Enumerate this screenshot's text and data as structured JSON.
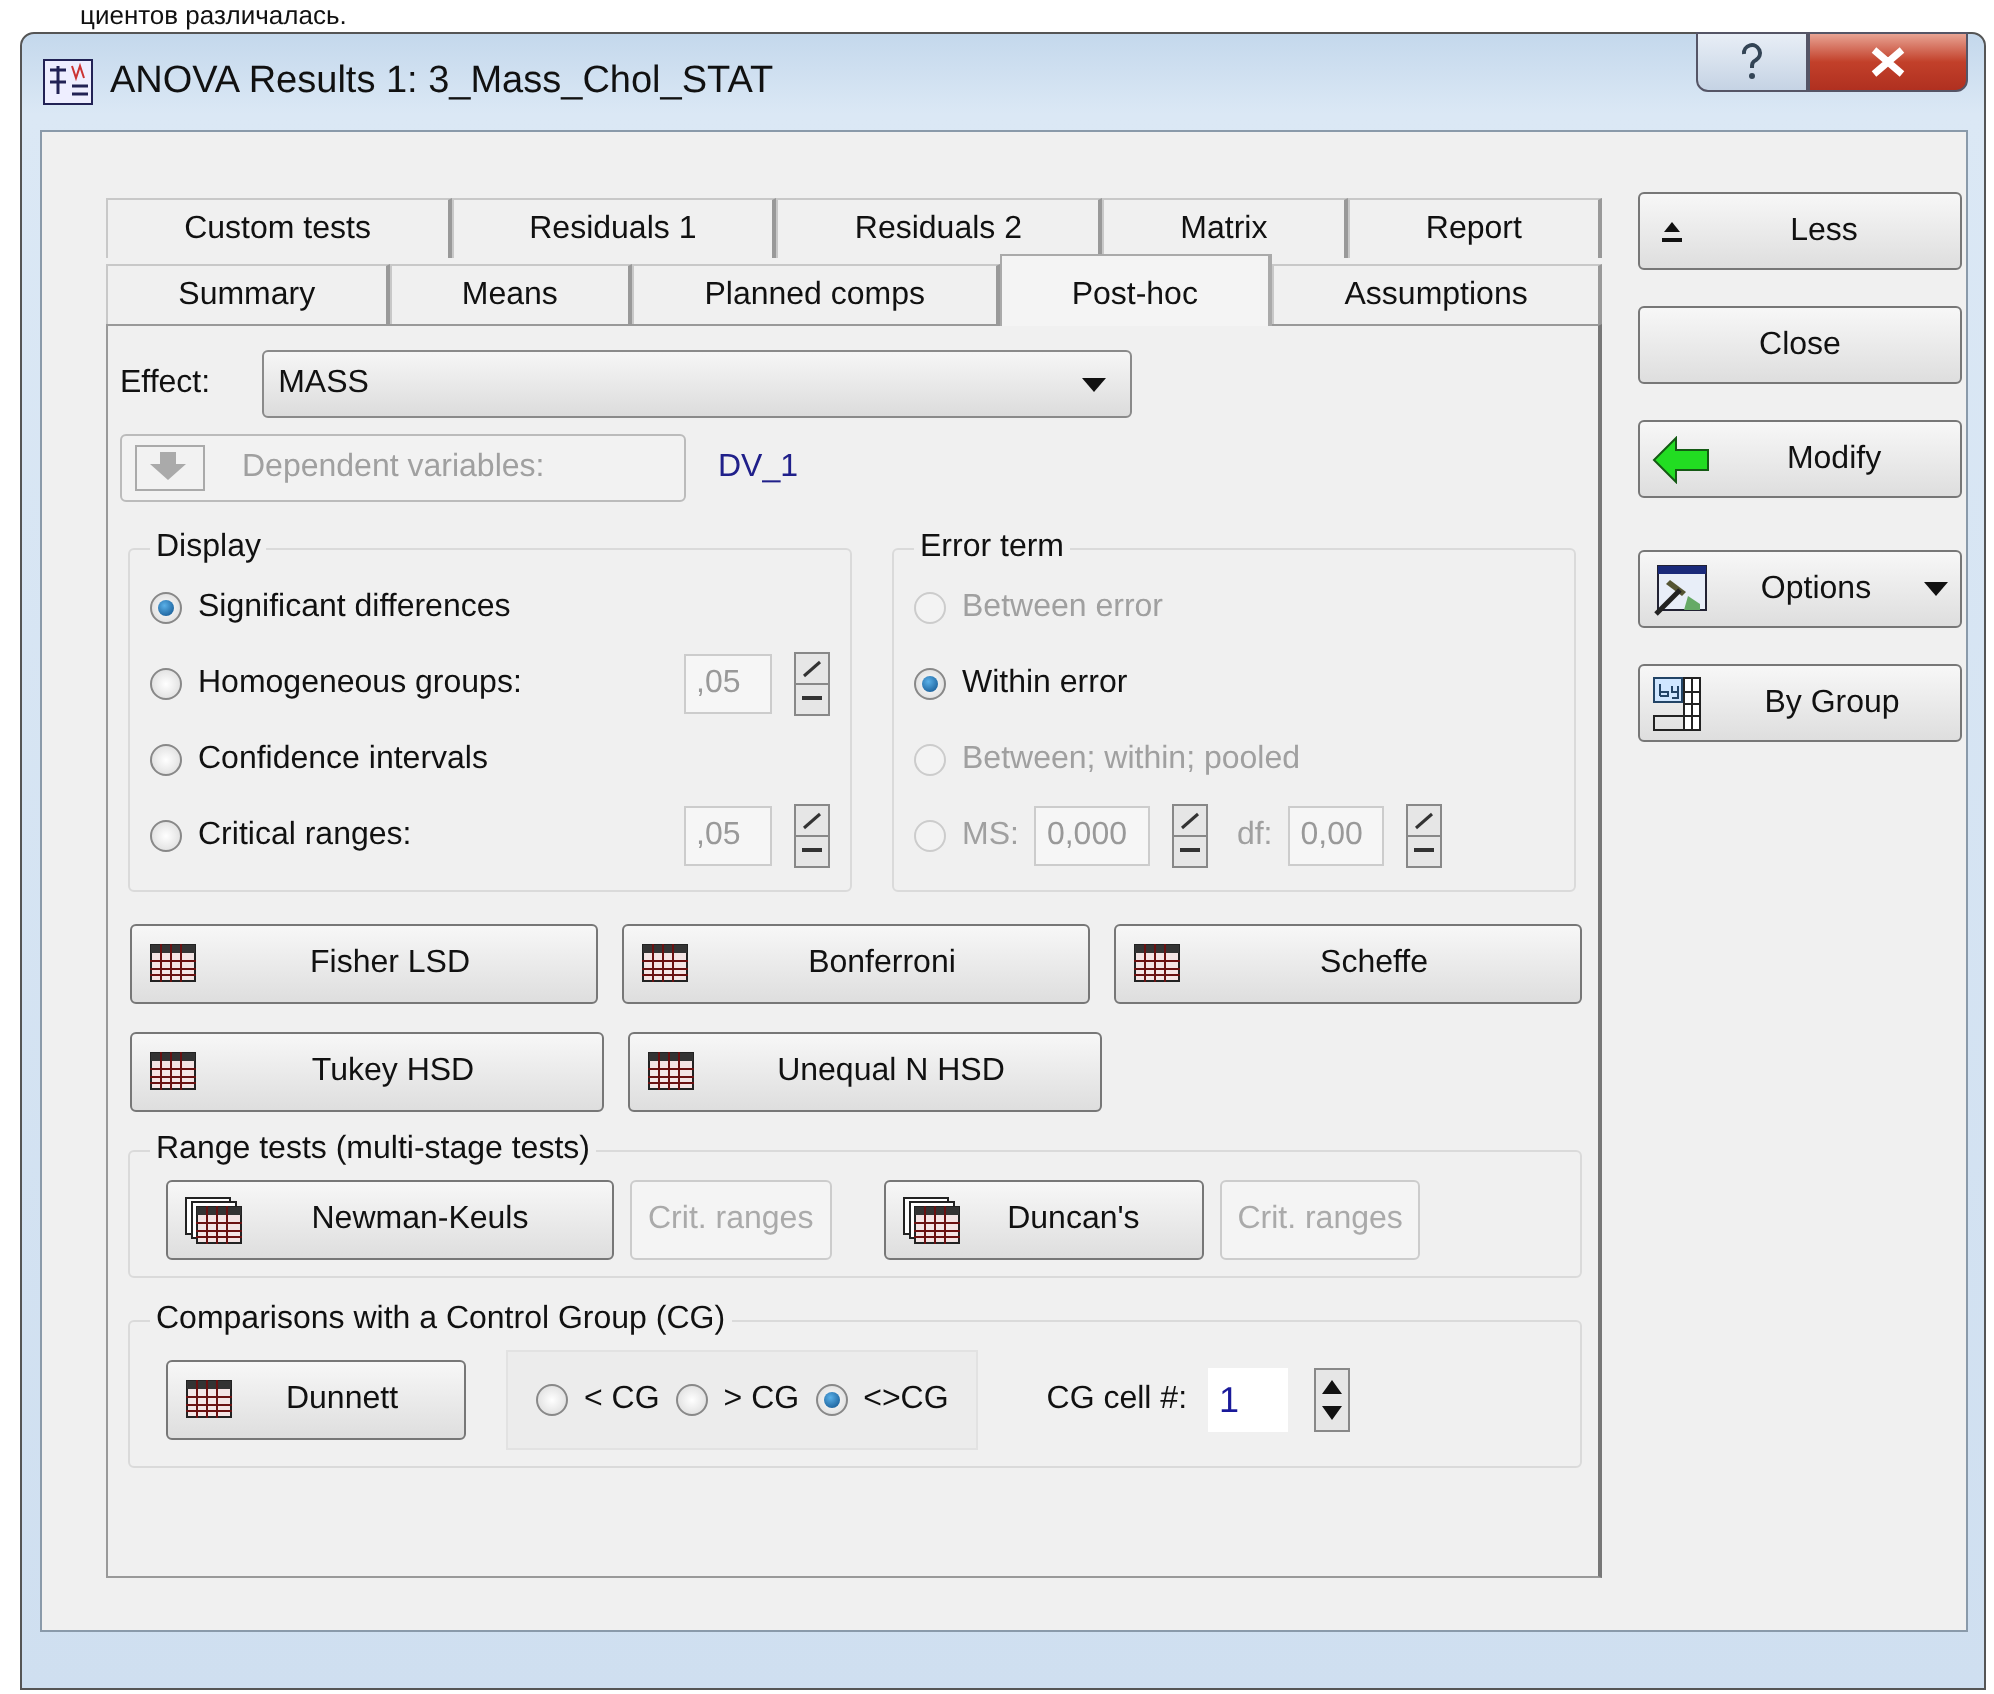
{
  "background_text": "циентов различалась.",
  "window": {
    "title": "ANOVA Results 1: 3_Mass_Chol_STAT"
  },
  "tab_rows": [
    [
      {
        "label": "Custom tests",
        "selected": false
      },
      {
        "label": "Residuals 1",
        "selected": false
      },
      {
        "label": "Residuals 2",
        "selected": false
      },
      {
        "label": "Matrix",
        "selected": false
      },
      {
        "label": "Report",
        "selected": false
      }
    ],
    [
      {
        "label": "Summary",
        "selected": false
      },
      {
        "label": "Means",
        "selected": false
      },
      {
        "label": "Planned comps",
        "selected": false
      },
      {
        "label": "Post-hoc",
        "selected": true
      },
      {
        "label": "Assumptions",
        "selected": false
      }
    ]
  ],
  "effect": {
    "label": "Effect:",
    "value": "MASS"
  },
  "dependent_variables": {
    "label": "Dependent variables:",
    "disabled": true,
    "value": "DV_1"
  },
  "display": {
    "title": "Display",
    "options": [
      {
        "label": "Significant differences",
        "selected": true
      },
      {
        "label": "Homogeneous groups:",
        "selected": false,
        "value": ",05"
      },
      {
        "label": "Confidence intervals",
        "selected": false
      },
      {
        "label": "Critical ranges:",
        "selected": false,
        "value": ",05"
      }
    ]
  },
  "error_term": {
    "title": "Error term",
    "options": [
      {
        "kind": "plain",
        "label": "Between error",
        "selected": false,
        "disabled": true
      },
      {
        "kind": "plain",
        "label": "Within error",
        "selected": true,
        "disabled": false
      },
      {
        "kind": "plain",
        "label": "Between; within; pooled",
        "selected": false,
        "disabled": true
      },
      {
        "kind": "ms",
        "label": "MS:",
        "value": "0,000",
        "df_label": "df:",
        "df_value": "0,00",
        "selected": false,
        "disabled": true
      }
    ]
  },
  "test_buttons": [
    [
      "Fisher LSD",
      "Bonferroni",
      "Scheffe"
    ],
    [
      "Tukey HSD",
      "Unequal N HSD"
    ]
  ],
  "range_tests": {
    "title": "Range tests (multi-stage tests)",
    "items": [
      {
        "label": "Newman-Keuls",
        "crit_label": "Crit. ranges",
        "crit_disabled": true
      },
      {
        "label": "Duncan's",
        "crit_label": "Crit. ranges",
        "crit_disabled": true
      }
    ]
  },
  "control_group": {
    "title": "Comparisons with a Control Group (CG)",
    "button": "Dunnett",
    "options": [
      {
        "label": "< CG",
        "selected": false
      },
      {
        "label": "> CG",
        "selected": false
      },
      {
        "label": "<>CG",
        "selected": true
      }
    ],
    "cell_label": "CG cell #:",
    "cell_value": "1"
  },
  "side_buttons": [
    {
      "kind": "less",
      "label": "Less"
    },
    {
      "kind": "plain",
      "label": "Close"
    },
    {
      "kind": "modify",
      "label": "Modify"
    },
    {
      "kind": "options",
      "label": "Options"
    },
    {
      "kind": "group",
      "label": "By Group"
    }
  ]
}
